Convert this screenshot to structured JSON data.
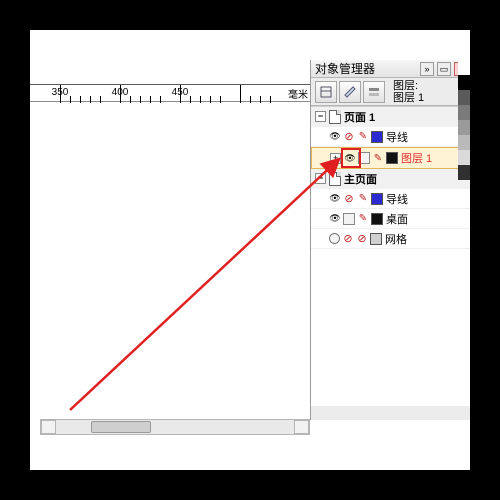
{
  "ruler": {
    "ticks": [
      "350",
      "400",
      "450"
    ],
    "unit": "毫米"
  },
  "panel": {
    "title": "对象管理器",
    "layer_caption": "图层:",
    "layer_current": "图层 1",
    "sections": {
      "page": "页面 1",
      "master": "主页面"
    },
    "rows": {
      "guides1": "导线",
      "layer1": "图层 1",
      "guides2": "导线",
      "desktop": "桌面",
      "grid": "网格"
    },
    "swatchColors": {
      "guides": "#2a2ad0",
      "layer1": "#111111",
      "desktop": "#111111",
      "grid": "#d0d0d0"
    }
  },
  "palette": [
    "#ffffff",
    "#000000",
    "#5a5a5a",
    "#7a7a7a",
    "#9a9a9a",
    "#bababa",
    "#dadada",
    "#303030"
  ]
}
